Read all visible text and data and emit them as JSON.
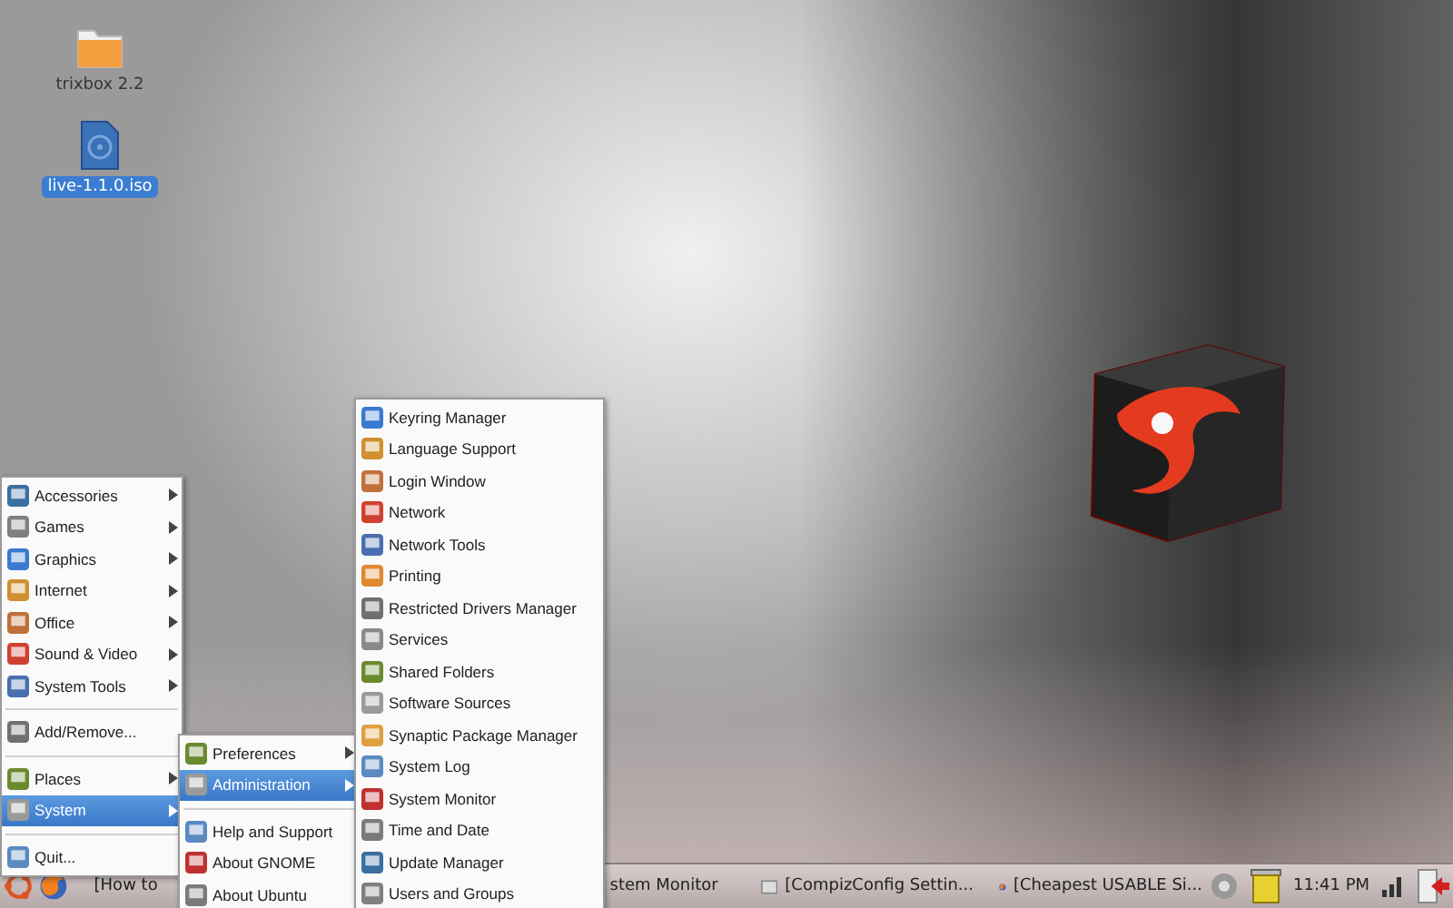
{
  "desktop": {
    "icons": [
      {
        "kind": "folder",
        "label": "trixbox 2.2",
        "selected": false
      },
      {
        "kind": "disc",
        "label": "live-1.1.0.iso",
        "selected": true
      }
    ]
  },
  "main_menu": {
    "items": [
      {
        "kind": "item",
        "label": "Accessories",
        "submenu": true,
        "selected": false
      },
      {
        "kind": "item",
        "label": "Games",
        "submenu": true,
        "selected": false
      },
      {
        "kind": "item",
        "label": "Graphics",
        "submenu": true,
        "selected": false
      },
      {
        "kind": "item",
        "label": "Internet",
        "submenu": true,
        "selected": false
      },
      {
        "kind": "item",
        "label": "Office",
        "submenu": true,
        "selected": false
      },
      {
        "kind": "item",
        "label": "Sound & Video",
        "submenu": true,
        "selected": false
      },
      {
        "kind": "item",
        "label": "System Tools",
        "submenu": true,
        "selected": false
      },
      {
        "kind": "separator"
      },
      {
        "kind": "item",
        "label": "Add/Remove...",
        "submenu": false,
        "selected": false
      },
      {
        "kind": "separator"
      },
      {
        "kind": "item",
        "label": "Places",
        "submenu": true,
        "selected": false
      },
      {
        "kind": "item",
        "label": "System",
        "submenu": true,
        "selected": true
      },
      {
        "kind": "separator"
      },
      {
        "kind": "item",
        "label": "Quit...",
        "submenu": false,
        "selected": false
      }
    ]
  },
  "system_menu": {
    "items": [
      {
        "kind": "item",
        "label": "Preferences",
        "submenu": true,
        "selected": false
      },
      {
        "kind": "item",
        "label": "Administration",
        "submenu": true,
        "selected": true
      },
      {
        "kind": "separator"
      },
      {
        "kind": "item",
        "label": "Help and Support",
        "submenu": false,
        "selected": false
      },
      {
        "kind": "item",
        "label": "About GNOME",
        "submenu": false,
        "selected": false
      },
      {
        "kind": "item",
        "label": "About Ubuntu",
        "submenu": false,
        "selected": false
      }
    ]
  },
  "administration_menu": {
    "items": [
      {
        "kind": "item",
        "label": "Keyring Manager",
        "submenu": false,
        "selected": false
      },
      {
        "kind": "item",
        "label": "Language Support",
        "submenu": false,
        "selected": false
      },
      {
        "kind": "item",
        "label": "Login Window",
        "submenu": false,
        "selected": false
      },
      {
        "kind": "item",
        "label": "Network",
        "submenu": false,
        "selected": false
      },
      {
        "kind": "item",
        "label": "Network Tools",
        "submenu": false,
        "selected": false
      },
      {
        "kind": "item",
        "label": "Printing",
        "submenu": false,
        "selected": false
      },
      {
        "kind": "item",
        "label": "Restricted Drivers Manager",
        "submenu": false,
        "selected": false
      },
      {
        "kind": "item",
        "label": "Services",
        "submenu": false,
        "selected": false
      },
      {
        "kind": "item",
        "label": "Shared Folders",
        "submenu": false,
        "selected": false
      },
      {
        "kind": "item",
        "label": "Software Sources",
        "submenu": false,
        "selected": false
      },
      {
        "kind": "item",
        "label": "Synaptic Package Manager",
        "submenu": false,
        "selected": false
      },
      {
        "kind": "item",
        "label": "System Log",
        "submenu": false,
        "selected": false
      },
      {
        "kind": "item",
        "label": "System Monitor",
        "submenu": false,
        "selected": false
      },
      {
        "kind": "item",
        "label": "Time and Date",
        "submenu": false,
        "selected": false
      },
      {
        "kind": "item",
        "label": "Update Manager",
        "submenu": false,
        "selected": false
      },
      {
        "kind": "item",
        "label": "Users and Groups",
        "submenu": false,
        "selected": false
      }
    ]
  },
  "taskbar": {
    "buttons": [
      {
        "label": "[How to"
      },
      {
        "label": "stem Monitor"
      },
      {
        "label": "[CompizConfig Settin..."
      },
      {
        "label": "[Cheapest USABLE Si..."
      }
    ],
    "clock": "11:41 PM"
  }
}
